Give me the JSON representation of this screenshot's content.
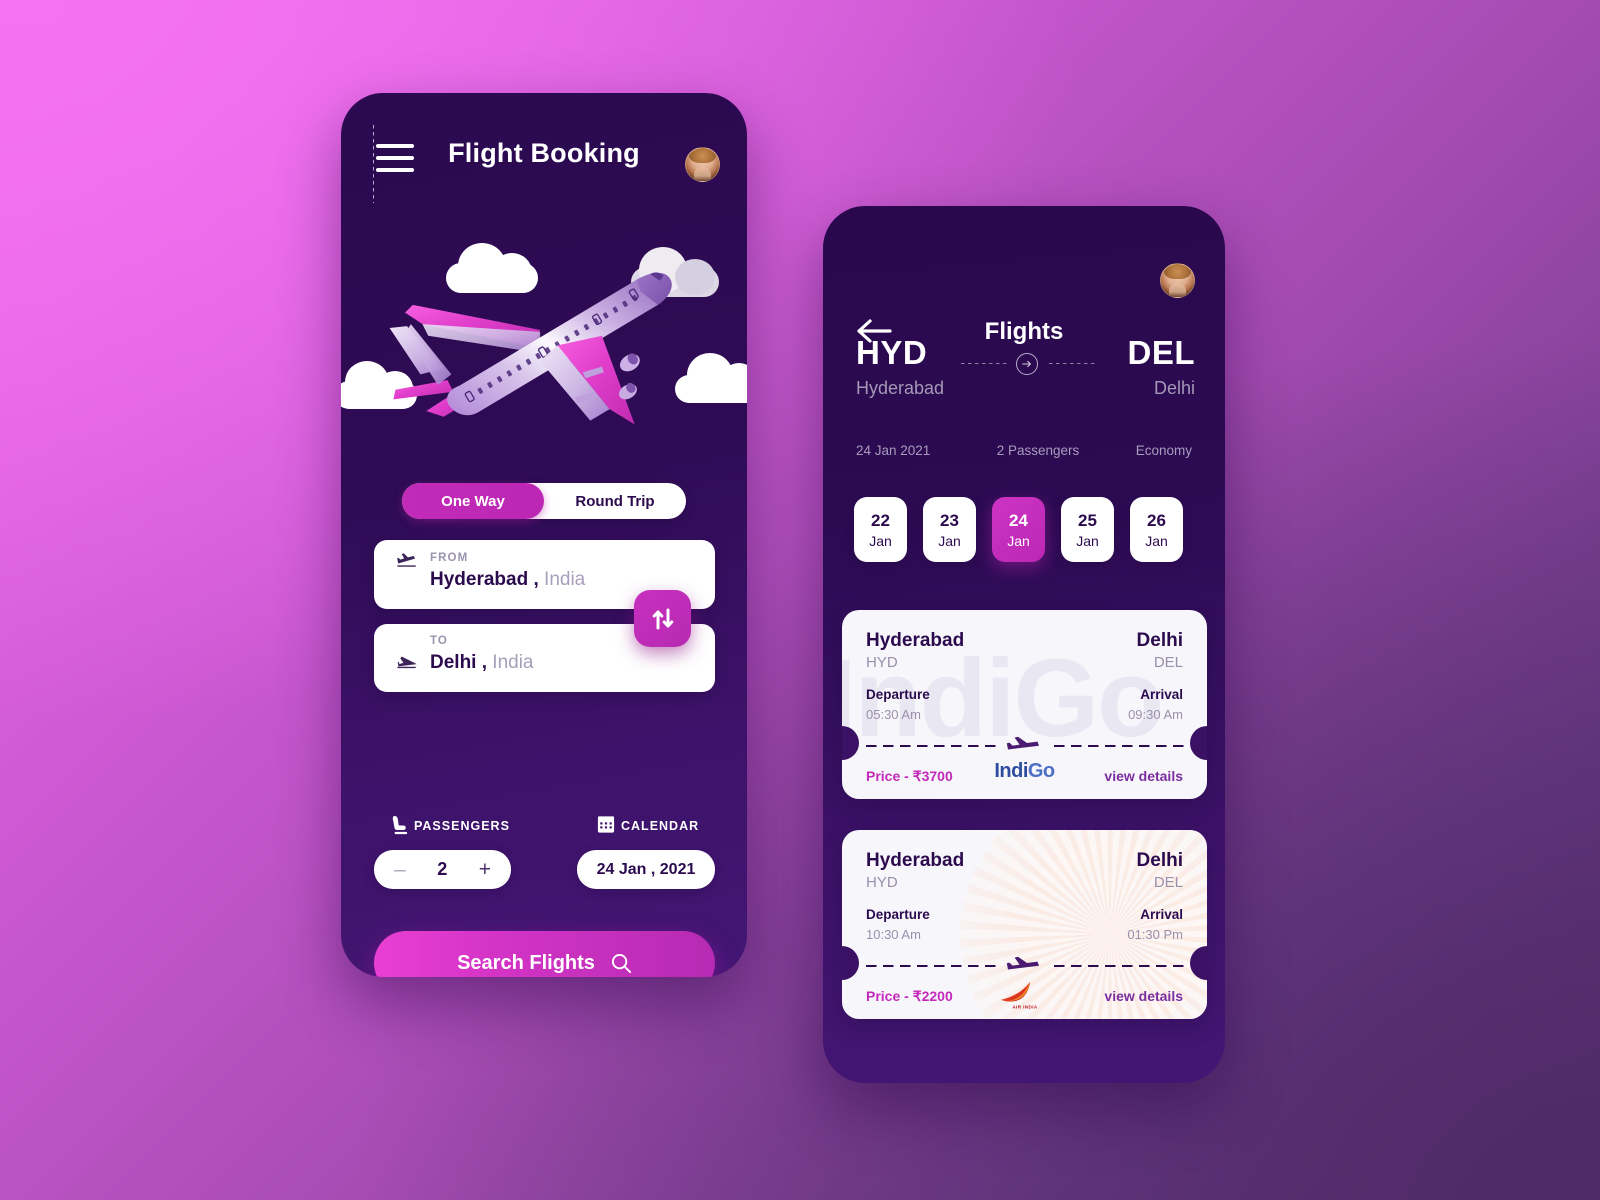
{
  "background": {
    "gradient_from": "#ef6cef",
    "gradient_to": "#5a3272"
  },
  "left_screen": {
    "header": {
      "menu_icon": "hamburger-menu-icon",
      "title": "Flight Booking",
      "avatar_icon": "user-avatar"
    },
    "illustration": {
      "icon": "airplane-illustration",
      "clouds": 4
    },
    "trip_type": {
      "options": [
        "One Way",
        "Round Trip"
      ],
      "selected": "One Way",
      "active_color": "#bb27b4"
    },
    "from_field": {
      "label": "FROM",
      "city": "Hyderabad ,",
      "country": "India",
      "icon": "plane-departure-icon"
    },
    "to_field": {
      "label": "TO",
      "city": "Delhi ,",
      "country": "India",
      "icon": "plane-arrival-icon"
    },
    "swap_button": {
      "icon": "swap-vertical-arrows-icon"
    },
    "passengers": {
      "label": "PASSENGERS",
      "icon": "seat-icon",
      "minus": "–",
      "count": "2",
      "plus": "+"
    },
    "calendar": {
      "label": "CALENDAR",
      "icon": "calendar-icon",
      "value": "24 Jan , 2021"
    },
    "search_button": {
      "label": "Search Flights",
      "icon": "search-icon"
    }
  },
  "right_screen": {
    "header": {
      "back_icon": "back-arrow-icon",
      "title": "Flights",
      "avatar_icon": "user-avatar"
    },
    "route": {
      "from_code": "HYD",
      "from_city": "Hyderabad",
      "to_code": "DEL",
      "to_city": "Delhi",
      "arrow_icon": "arrow-right-circle-icon"
    },
    "trip_meta": {
      "date": "24 Jan 2021",
      "passengers": "2 Passengers",
      "cabin_class": "Economy"
    },
    "date_chips": [
      {
        "day": "22",
        "month": "Jan",
        "selected": false
      },
      {
        "day": "23",
        "month": "Jan",
        "selected": false
      },
      {
        "day": "24",
        "month": "Jan",
        "selected": true
      },
      {
        "day": "25",
        "month": "Jan",
        "selected": false
      },
      {
        "day": "26",
        "month": "Jan",
        "selected": false
      }
    ],
    "flight_cards": [
      {
        "from_city": "Hyderabad",
        "from_code": "HYD",
        "to_city": "Delhi",
        "to_code": "DEL",
        "departure_label": "Departure",
        "departure_time": "05:30 Am",
        "arrival_label": "Arrival",
        "arrival_time": "09:30 Am",
        "price": "Price -  ₹3700",
        "airline": "IndiGo",
        "airline_logo": "indigo-logo",
        "watermark": "IndiGo",
        "details_link": "view details"
      },
      {
        "from_city": "Hyderabad",
        "from_code": "HYD",
        "to_city": "Delhi",
        "to_code": "DEL",
        "departure_label": "Departure",
        "departure_time": "10:30 Am",
        "arrival_label": "Arrival",
        "arrival_time": "01:30 Pm",
        "price": "Price -  ₹2200",
        "airline": "Air India",
        "airline_logo": "air-india-logo",
        "watermark": "air-india-sunburst",
        "details_link": "view details"
      }
    ]
  }
}
